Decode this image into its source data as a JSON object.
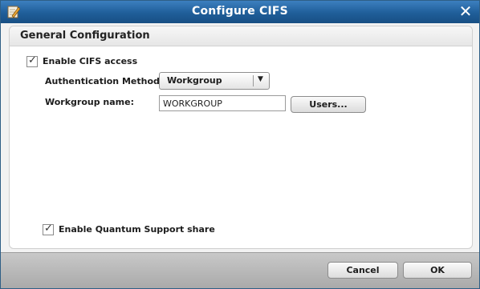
{
  "dialog": {
    "title": "Configure CIFS",
    "close_icon": "close-icon",
    "app_icon": "edit-icon"
  },
  "panel": {
    "title": "General Configuration"
  },
  "cifs": {
    "enable_label": "Enable CIFS access",
    "enabled": true,
    "auth_label": "Authentication Method:",
    "auth_value": "Workgroup",
    "workgroup_label": "Workgroup name:",
    "workgroup_value": "WORKGROUP",
    "users_button": "Users..."
  },
  "support_share": {
    "label": "Enable Quantum Support share",
    "enabled": true
  },
  "footer": {
    "cancel_label": "Cancel",
    "ok_label": "OK"
  }
}
